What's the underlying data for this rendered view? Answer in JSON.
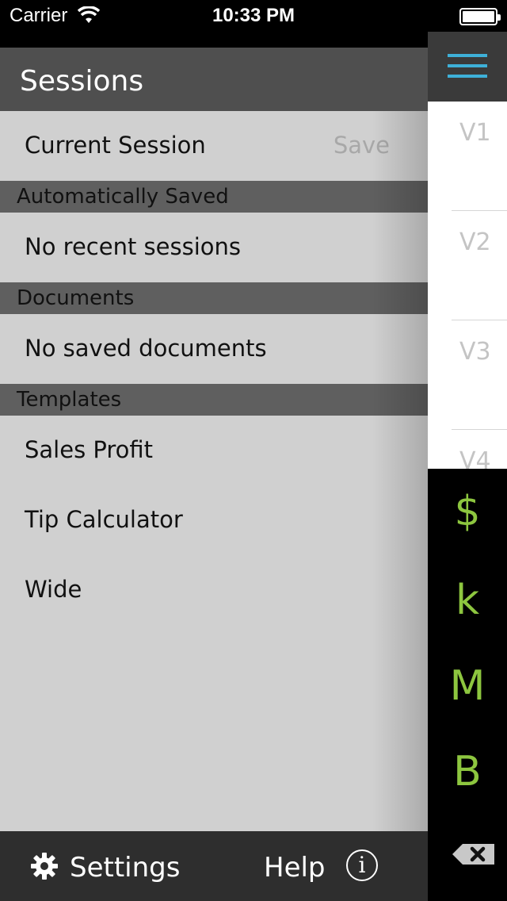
{
  "status_bar": {
    "carrier": "Carrier",
    "time": "10:33 PM"
  },
  "drawer": {
    "title": "Sessions",
    "current_session": {
      "label": "Current Session",
      "action": "Save"
    },
    "sections": [
      {
        "label": "Automatically Saved",
        "empty_text": "No recent sessions"
      },
      {
        "label": "Documents",
        "empty_text": "No saved documents"
      },
      {
        "label": "Templates",
        "items": [
          "Sales Profit",
          "Tip Calculator",
          "Wide"
        ]
      }
    ],
    "footer": {
      "settings_label": "Settings",
      "help_label": "Help",
      "info_glyph": "i"
    }
  },
  "right_panel": {
    "menu_icon": "hamburger-icon",
    "accent_color": "#3eb0d8",
    "variables": [
      "V1",
      "V2",
      "V3",
      "V4"
    ],
    "unit_keys": [
      "$",
      "k",
      "M",
      "B"
    ],
    "unit_color": "#8dc63f",
    "backspace_icon": "backspace-icon"
  }
}
